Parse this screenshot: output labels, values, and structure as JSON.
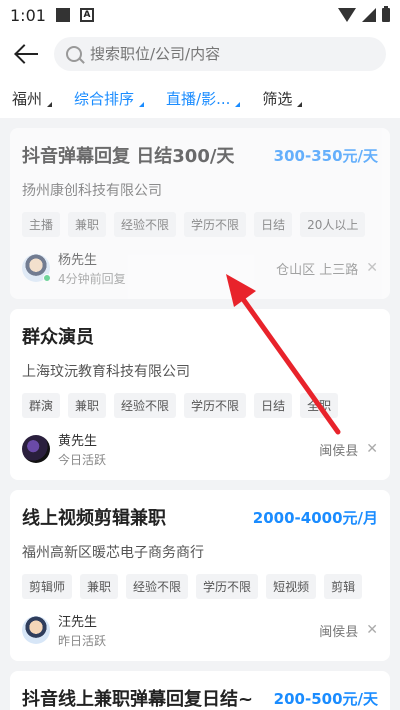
{
  "status": {
    "time": "1:01",
    "icon_a": "A"
  },
  "search": {
    "placeholder": "搜索职位/公司/内容"
  },
  "filters": [
    {
      "label": "福州",
      "active": false
    },
    {
      "label": "综合排序",
      "active": true
    },
    {
      "label": "直播/影...",
      "active": true
    },
    {
      "label": "筛选",
      "active": false
    }
  ],
  "jobs": [
    {
      "title": "抖音弹幕回复 日结300/天",
      "salary": "300-350元/天",
      "company": "扬州康创科技有限公司",
      "tags": [
        "主播",
        "兼职",
        "经验不限",
        "学历不限",
        "日结",
        "20人以上"
      ],
      "recruiter": "杨先生",
      "status": "4分钟前回复",
      "location": "仓山区 上三路"
    },
    {
      "title": "群众演员",
      "salary": "",
      "company": "上海玟沅教育科技有限公司",
      "tags": [
        "群演",
        "兼职",
        "经验不限",
        "学历不限",
        "日结",
        "全职"
      ],
      "recruiter": "黄先生",
      "status": "今日活跃",
      "location": "闽侯县"
    },
    {
      "title": "线上视频剪辑兼职",
      "salary": "2000-4000元/月",
      "company": "福州高新区暖芯电子商务商行",
      "tags": [
        "剪辑师",
        "兼职",
        "经验不限",
        "学历不限",
        "短视频",
        "剪辑"
      ],
      "recruiter": "汪先生",
      "status": "昨日活跃",
      "location": "闽侯县"
    },
    {
      "title": "抖音线上兼职弹幕回复日结~",
      "salary": "200-500元/天"
    }
  ],
  "colors": {
    "accent": "#1a8cff",
    "arrow": "#e8232b",
    "online": "#2bc46a"
  }
}
